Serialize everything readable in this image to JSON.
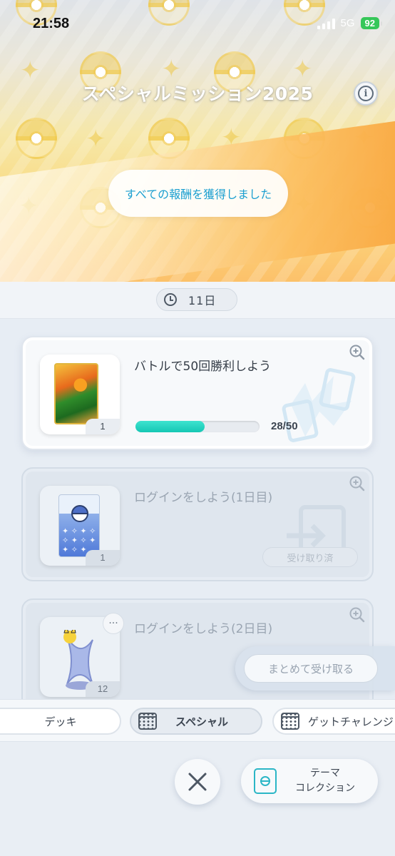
{
  "status_bar": {
    "time": "21:58",
    "network": "5G",
    "battery": "92"
  },
  "header": {
    "title": "スペシャルミッション2025",
    "info_icon": "info-icon",
    "reward_status": "すべての報酬を獲得しました"
  },
  "timer": {
    "icon": "clock-icon",
    "remaining": "11日"
  },
  "missions": [
    {
      "title": "バトルで50回勝利しよう",
      "reward_count": "1",
      "progress_text": "28/50",
      "progress_fraction": 0.56,
      "state": "active"
    },
    {
      "title": "ログインをしよう(1日目)",
      "reward_count": "1",
      "claimed_label": "受け取り済",
      "state": "claimed"
    },
    {
      "title": "ログインをしよう(2日目)",
      "reward_count": "12",
      "state": "claimed"
    }
  ],
  "bulk_claim": {
    "label": "まとめて受け取る"
  },
  "tabs": [
    {
      "label": "デッキ",
      "active": false
    },
    {
      "label": "スペシャル",
      "active": true
    },
    {
      "label": "ゲットチャレンジ",
      "active": false
    }
  ],
  "bottom": {
    "close_icon": "close-icon",
    "theme_button": {
      "line1": "テーマ",
      "line2": "コレクション"
    }
  },
  "colors": {
    "accent_teal": "#15c7b4",
    "reward_text_blue": "#1b9fd0",
    "battery_green": "#35c759"
  }
}
